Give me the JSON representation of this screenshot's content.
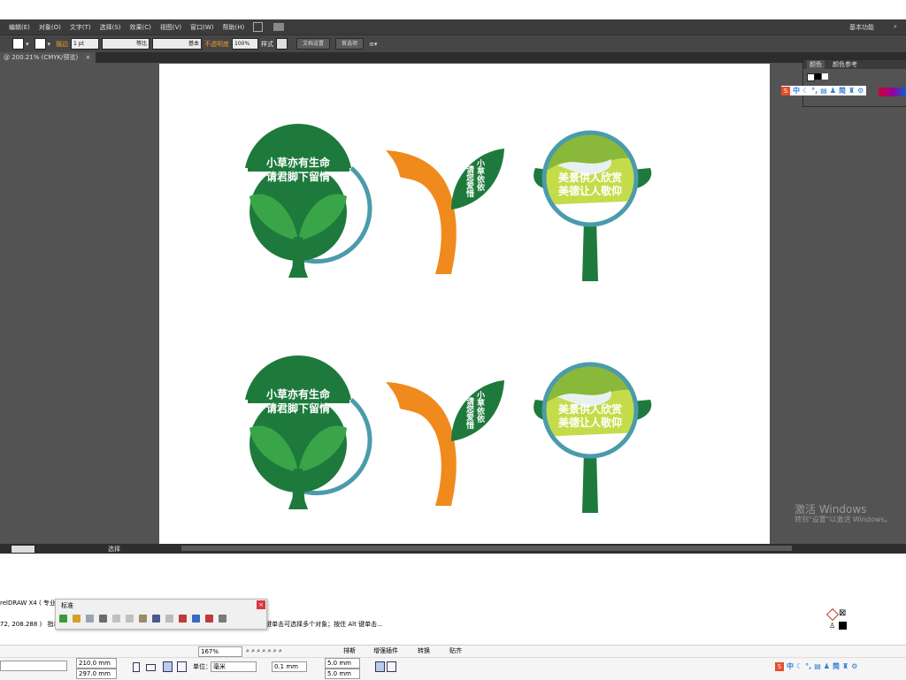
{
  "ai": {
    "menu": [
      "编辑(E)",
      "对象(O)",
      "文字(T)",
      "选择(S)",
      "效果(C)",
      "视图(V)",
      "窗口(W)",
      "帮助(H)"
    ],
    "workspace": "基本功能",
    "control": {
      "stroke_label": "描边",
      "stroke_weight": "1 pt",
      "profile": "等比",
      "brush": "基本",
      "opacity_label": "不透明度",
      "opacity": "100%",
      "style_label": "样式",
      "doc_setup": "文档设置",
      "prefs": "首选项"
    },
    "doc_tab": "@ 200.21% (CMYK/预览)",
    "panel": {
      "tab1": "颜色",
      "tab2": "颜色参考"
    },
    "status_mode": "选择",
    "windows_watermark": {
      "line1": "激活 Windows",
      "line2": "转到\"设置\"以激活 Windows。"
    }
  },
  "signs": {
    "tree_top": "小草亦有生命",
    "tree_bottom": "请君脚下留情",
    "leaf_1": "小草依依",
    "leaf_2": "请您爱惜",
    "circle_1": "美景供人欣赏",
    "circle_2": "美德让人敬仰"
  },
  "cd": {
    "title": "relDRAW X4 ( 专业版",
    "coords": "72, 208.288 )",
    "coords_tail": "指着",
    "hint": "Shift 键单击可选择多个对象；按住 Alt 键单击...",
    "toolbar_title": "标准",
    "zoom": "167%",
    "buttons": [
      "排斯",
      "增强插件",
      "转换",
      "贴齐"
    ],
    "width": "210.0 mm",
    "height": "297.0 mm",
    "unit_label": "单位：",
    "unit": "毫米",
    "nudge": "0.1 mm",
    "dup_x": "5.0 mm",
    "dup_y": "5.0 mm"
  },
  "ime": [
    "中",
    "简"
  ],
  "colors": {
    "green": "#1e7a3c",
    "light_green": "#3aa548",
    "orange": "#f08a1c",
    "ring": "#4a9bab"
  }
}
